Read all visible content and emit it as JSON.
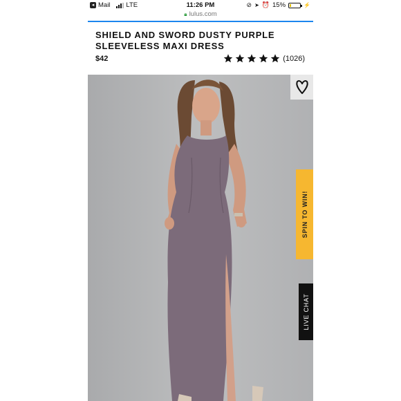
{
  "status_bar": {
    "back_app": "Mail",
    "network": "LTE",
    "time": "11:26 PM",
    "battery": "15%",
    "battery_level": 0.15
  },
  "url_bar": {
    "domain": "lulus.com"
  },
  "product": {
    "title_line1": "SHIELD AND SWORD DUSTY PURPLE",
    "title_line2": "SLEEVELESS MAXI DRESS",
    "price": "$42",
    "rating_stars": 5,
    "review_count": "(1026)"
  },
  "side_tabs": {
    "spin_label": "SPIN TO WIN!",
    "chat_label": "LIVE CHAT"
  },
  "icons": {
    "back": "back-arrow-icon",
    "wishlist": "heart-outline-icon",
    "lock": "lock-icon",
    "star": "star-icon"
  },
  "colors": {
    "accent_blue": "#1c86ee",
    "spin_tab": "#f6b730",
    "chat_tab": "#111111",
    "dress": "#7c6b7a",
    "photo_bg": "#b4b5b6"
  }
}
